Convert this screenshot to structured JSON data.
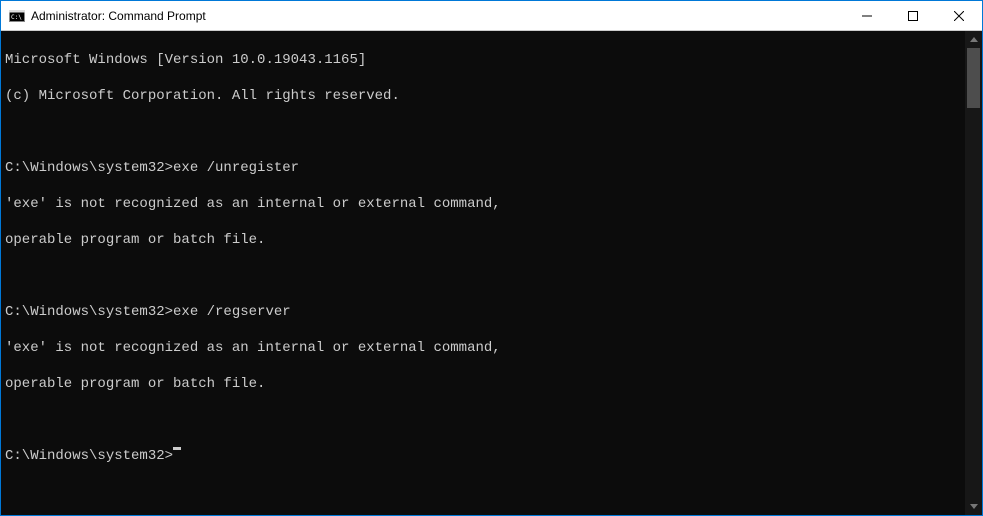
{
  "titlebar": {
    "title": "Administrator: Command Prompt"
  },
  "console": {
    "header1": "Microsoft Windows [Version 10.0.19043.1165]",
    "header2": "(c) Microsoft Corporation. All rights reserved.",
    "blank": "",
    "prompt1": "C:\\Windows\\system32>exe /unregister",
    "err1a": "'exe' is not recognized as an internal or external command,",
    "err1b": "operable program or batch file.",
    "prompt2": "C:\\Windows\\system32>exe /regserver",
    "err2a": "'exe' is not recognized as an internal or external command,",
    "err2b": "operable program or batch file.",
    "prompt3": "C:\\Windows\\system32>"
  }
}
